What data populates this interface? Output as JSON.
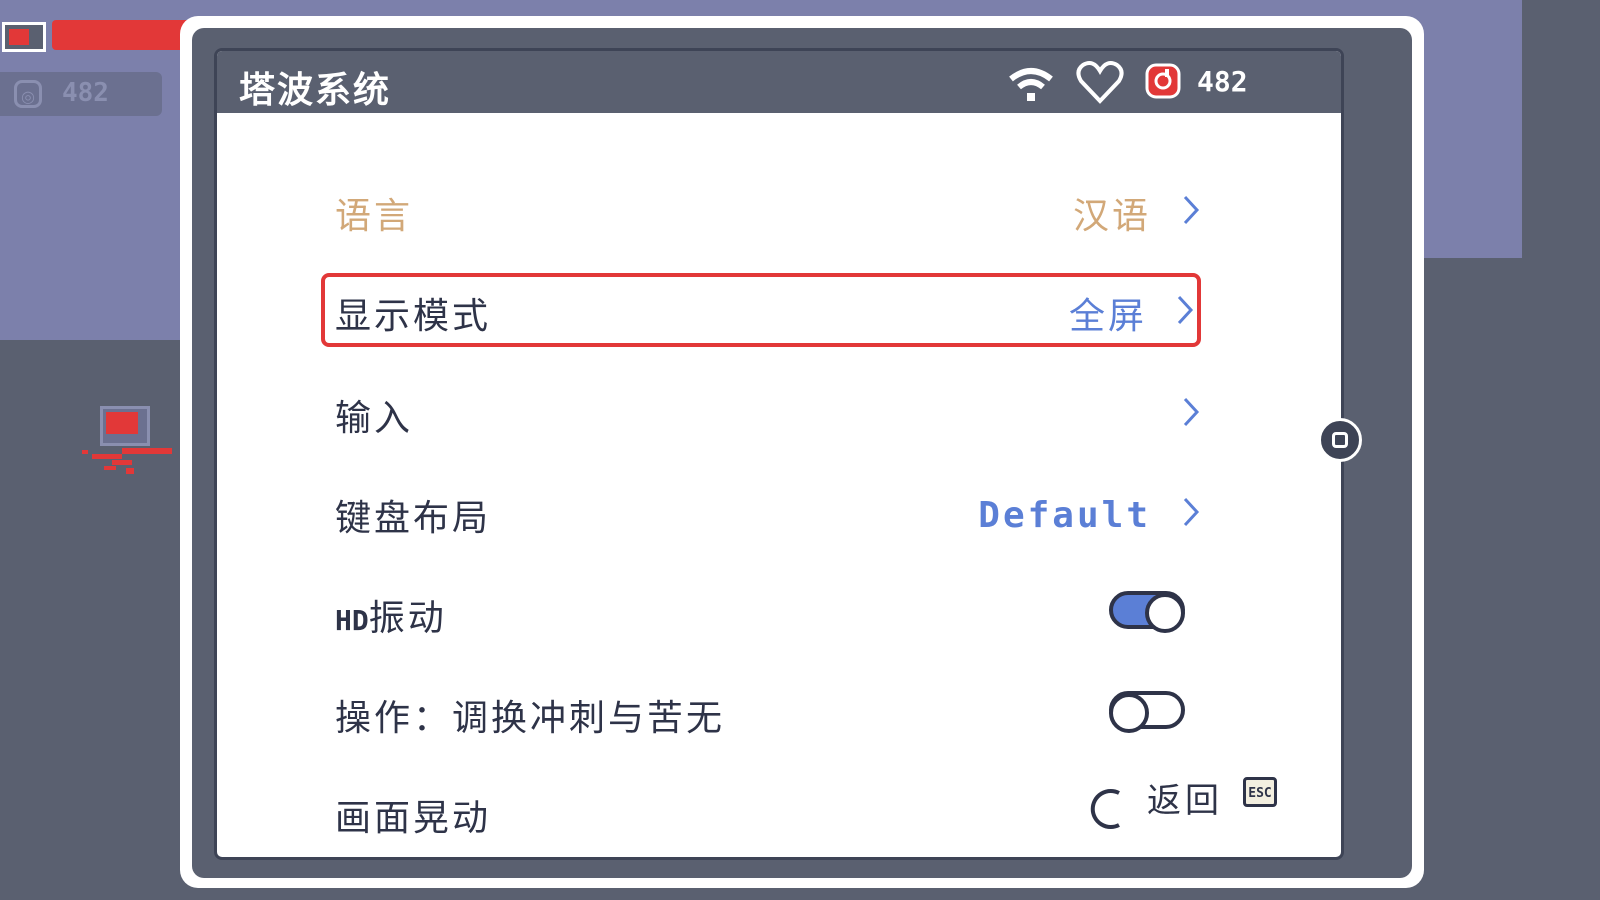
{
  "hud": {
    "coins": "482"
  },
  "header": {
    "title": "塔波系统",
    "coins": "482",
    "icons": [
      "wifi-icon",
      "heart-icon",
      "coin-icon"
    ]
  },
  "settings": [
    {
      "label": "语言",
      "value": "汉语",
      "type": "select",
      "color": "#d2a878",
      "value_color": "#d2a878"
    },
    {
      "label": "显示模式",
      "value": "全屏",
      "type": "select",
      "selected": true,
      "value_color": "#5b7fd6"
    },
    {
      "label": "输入",
      "value": "",
      "type": "select"
    },
    {
      "label": "键盘布局",
      "value": "Default",
      "type": "select",
      "value_color": "#5b7fd6"
    },
    {
      "label_prefix": "HD",
      "label": "振动",
      "type": "toggle",
      "on": true
    },
    {
      "label": "操作：调换冲刺与苦无",
      "type": "toggle",
      "on": false
    },
    {
      "label": "画面晃动",
      "type": "loading"
    }
  ],
  "footer": {
    "back_label": "返回",
    "back_key": "ESC"
  },
  "colors": {
    "accent": "#5b7fd6",
    "highlight": "#e23838",
    "muted_gold": "#d2a878",
    "panel_dark": "#5a6070"
  }
}
